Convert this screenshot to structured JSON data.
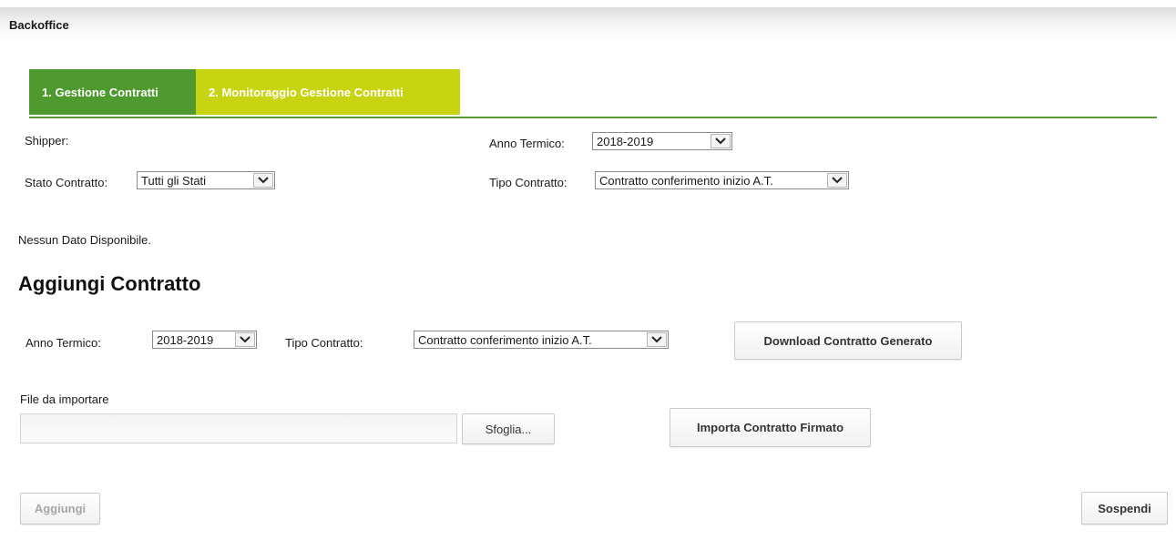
{
  "header": {
    "title": "Backoffice"
  },
  "tabs": [
    {
      "label": "1. Gestione Contratti",
      "active": true,
      "color": "#4f9a2e"
    },
    {
      "label": "2. Monitoraggio Gestione Contratti",
      "active": false,
      "color": "#c8d412"
    }
  ],
  "filters": {
    "shipper_label": "Shipper:",
    "anno_termico_label": "Anno Termico:",
    "anno_termico_value": "2018-2019",
    "stato_contratto_label": "Stato Contratto:",
    "stato_contratto_value": "Tutti gli Stati",
    "tipo_contratto_label": "Tipo Contratto:",
    "tipo_contratto_value": "Contratto conferimento inizio A.T."
  },
  "results": {
    "empty_message": "Nessun Dato Disponibile."
  },
  "add_contract": {
    "title": "Aggiungi Contratto",
    "anno_termico_label": "Anno Termico:",
    "anno_termico_value": "2018-2019",
    "tipo_contratto_label": "Tipo Contratto:",
    "tipo_contratto_value": "Contratto conferimento inizio A.T.",
    "download_button": "Download Contratto Generato",
    "file_label": "File da importare",
    "file_value": "",
    "browse_button": "Sfoglia...",
    "import_button": "Importa Contratto Firmato"
  },
  "footer": {
    "add_button": "Aggiungi",
    "suspend_button": "Sospendi"
  },
  "icons": {
    "select_arrow": "chevron-down-icon"
  }
}
